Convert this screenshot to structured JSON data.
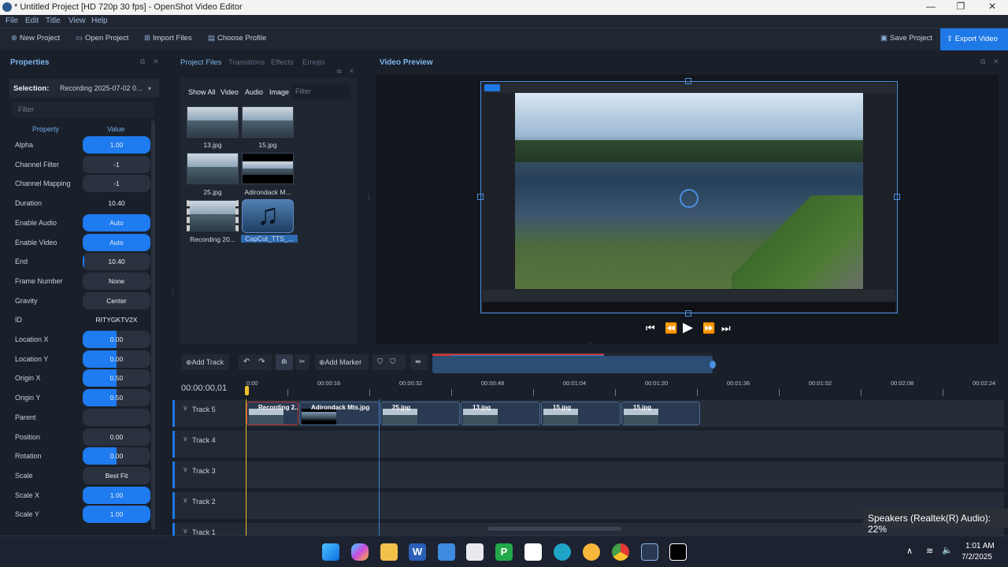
{
  "window": {
    "title": "* Untitled Project [HD 720p 30 fps] - OpenShot Video Editor",
    "min": "—",
    "max": "❐",
    "close": "✕"
  },
  "menu": [
    "File",
    "Edit",
    "Title",
    "View",
    "Help"
  ],
  "toolbar": {
    "new": "New Project",
    "open": "Open Project",
    "import": "Import Files",
    "profile": "Choose Profile",
    "save": "Save Project",
    "export": "Export Video"
  },
  "properties": {
    "title": "Properties",
    "selection_label": "Selection:",
    "selection_value": "Recording 2025-07-02 0...",
    "filter_placeholder": "Filter",
    "col_property": "Property",
    "col_value": "Value",
    "rows": [
      {
        "name": "Alpha",
        "value": "1.00",
        "fill": 1.0
      },
      {
        "name": "Channel Filter",
        "value": "-1",
        "fill": 0
      },
      {
        "name": "Channel Mapping",
        "value": "-1",
        "fill": 0
      },
      {
        "name": "Duration",
        "value": "10.40",
        "fill": 0
      },
      {
        "name": "Enable Audio",
        "value": "Auto",
        "fill": 1.0
      },
      {
        "name": "Enable Video",
        "value": "Auto",
        "fill": 1.0
      },
      {
        "name": "End",
        "value": "10.40",
        "fill": 0.02
      },
      {
        "name": "Frame Number",
        "value": "None",
        "fill": 0
      },
      {
        "name": "Gravity",
        "value": "Center",
        "fill": 0
      },
      {
        "name": "ID",
        "value": "RITYGKTV2X",
        "fill": 0
      },
      {
        "name": "Location X",
        "value": "0.00",
        "fill": 0.5
      },
      {
        "name": "Location Y",
        "value": "0.00",
        "fill": 0.5
      },
      {
        "name": "Origin X",
        "value": "0.50",
        "fill": 0.5
      },
      {
        "name": "Origin Y",
        "value": "0.50",
        "fill": 0.5
      },
      {
        "name": "Parent",
        "value": "",
        "fill": 0
      },
      {
        "name": "Position",
        "value": "0.00",
        "fill": 0
      },
      {
        "name": "Rotation",
        "value": "0.00",
        "fill": 0.5
      },
      {
        "name": "Scale",
        "value": "Best Fit",
        "fill": 0
      },
      {
        "name": "Scale X",
        "value": "1.00",
        "fill": 1.0
      },
      {
        "name": "Scale Y",
        "value": "1.00",
        "fill": 1.0
      }
    ]
  },
  "files": {
    "tabs": [
      "Project Files",
      "Transitions",
      "Effects",
      "Emojis"
    ],
    "filters": [
      "Show All",
      "Video",
      "Audio",
      "Image"
    ],
    "filter_placeholder": "Filter",
    "items": [
      "13.jpg",
      "15.jpg",
      "25.jpg",
      "Adirondack M...",
      "Recording 20...",
      "CapCut_TTS_..."
    ]
  },
  "preview": {
    "title": "Video Preview"
  },
  "timeline": {
    "add_track": "Add Track",
    "add_marker": "Add Marker",
    "timecode": "00:00:00,01",
    "ticks": [
      "0:00",
      "00:00:16",
      "00:00:32",
      "00:00:48",
      "00:01:04",
      "00:01:20",
      "00:01:36",
      "00:01:52",
      "00:02:08",
      "00:02:24"
    ],
    "tracks": [
      "Track 5",
      "Track 4",
      "Track 3",
      "Track 2",
      "Track 1"
    ],
    "clips": [
      "Recording 2...",
      "Adirondack Mts.jpg",
      "25.jpg",
      "13.jpg",
      "15.jpg",
      "15.jpg"
    ]
  },
  "notification": "Speakers (Realtek(R) Audio): 22%",
  "taskbar": {
    "time": "1:01 AM",
    "date": "7/2/2025"
  },
  "colors": {
    "accent": "#1e78e6",
    "panel": "#1a202a"
  }
}
